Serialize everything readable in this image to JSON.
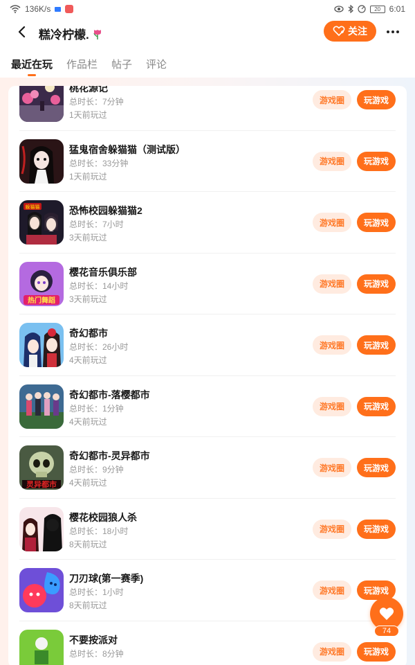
{
  "status_bar": {
    "net_speed": "136K/s",
    "battery": "20",
    "time": "6:01"
  },
  "header": {
    "title": "糕冷柠檬.",
    "follow_label": "关注",
    "accent_color": "#ff6f1a"
  },
  "tabs": [
    {
      "label": "最近在玩",
      "active": true
    },
    {
      "label": "作品栏",
      "active": false
    },
    {
      "label": "帖子",
      "active": false
    },
    {
      "label": "评论",
      "active": false
    }
  ],
  "games": [
    {
      "name": "桃花源记",
      "duration": "总时长：7分钟",
      "last_played": "1天前玩过",
      "circle_label": "游戏圈",
      "play_label": "玩游戏",
      "icon": "peach-blossom-art"
    },
    {
      "name": "猛鬼宿舍躲猫猫（测试版）",
      "duration": "总时长：33分钟",
      "last_played": "1天前玩过",
      "circle_label": "游戏圈",
      "play_label": "玩游戏",
      "icon": "ghost-girl-art"
    },
    {
      "name": "恐怖校园躲猫猫2",
      "duration": "总时长：7小时",
      "last_played": "3天前玩过",
      "circle_label": "游戏圈",
      "play_label": "玩游戏",
      "icon": "horror-school-art",
      "icon_text": "躲猫猫"
    },
    {
      "name": "樱花音乐俱乐部",
      "duration": "总时长：14小时",
      "last_played": "3天前玩过",
      "circle_label": "游戏圈",
      "play_label": "玩游戏",
      "icon": "music-club-art",
      "icon_text": "热门舞蹈"
    },
    {
      "name": "奇幻都市",
      "duration": "总时长：26小时",
      "last_played": "4天前玩过",
      "circle_label": "游戏圈",
      "play_label": "玩游戏",
      "icon": "fantasy-city-art"
    },
    {
      "name": "奇幻都市-落樱都市",
      "duration": "总时长：1分钟",
      "last_played": "4天前玩过",
      "circle_label": "游戏圈",
      "play_label": "玩游戏",
      "icon": "sakura-city-art"
    },
    {
      "name": "奇幻都市-灵异都市",
      "duration": "总时长：9分钟",
      "last_played": "4天前玩过",
      "circle_label": "游戏圈",
      "play_label": "玩游戏",
      "icon": "skull-city-art",
      "icon_text": "灵异都市"
    },
    {
      "name": "樱花校园狼人杀",
      "duration": "总时长：18小时",
      "last_played": "8天前玩过",
      "circle_label": "游戏圈",
      "play_label": "玩游戏",
      "icon": "werewolf-art"
    },
    {
      "name": "刀刃球(第一赛季)",
      "duration": "总时长：1小时",
      "last_played": "8天前玩过",
      "circle_label": "游戏圈",
      "play_label": "玩游戏",
      "icon": "blade-ball-art"
    },
    {
      "name": "不要按派对",
      "duration": "总时长：8分钟",
      "last_played": "",
      "circle_label": "游戏圈",
      "play_label": "玩游戏",
      "icon": "party-art"
    }
  ],
  "like": {
    "count": "74",
    "icon": "heart-icon"
  }
}
